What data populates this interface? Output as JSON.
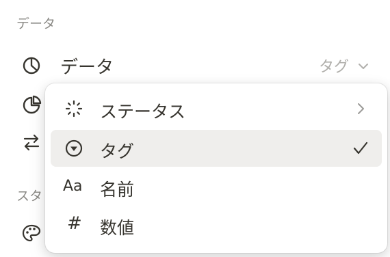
{
  "section": {
    "title": "データ"
  },
  "property": {
    "name": "データ",
    "value": "タグ",
    "icon": "pie-chart-icon"
  },
  "section2": {
    "title_partial": "スタ"
  },
  "menu": {
    "items": [
      {
        "label": "ステータス",
        "icon": "status-spinner-icon",
        "trailing": "chevron-right-icon"
      },
      {
        "label": "タグ",
        "icon": "select-icon",
        "trailing": "checkmark-icon",
        "selected": true
      },
      {
        "label": "名前",
        "icon_text": "Aa"
      },
      {
        "label": "数値",
        "icon_text": "#"
      }
    ]
  }
}
